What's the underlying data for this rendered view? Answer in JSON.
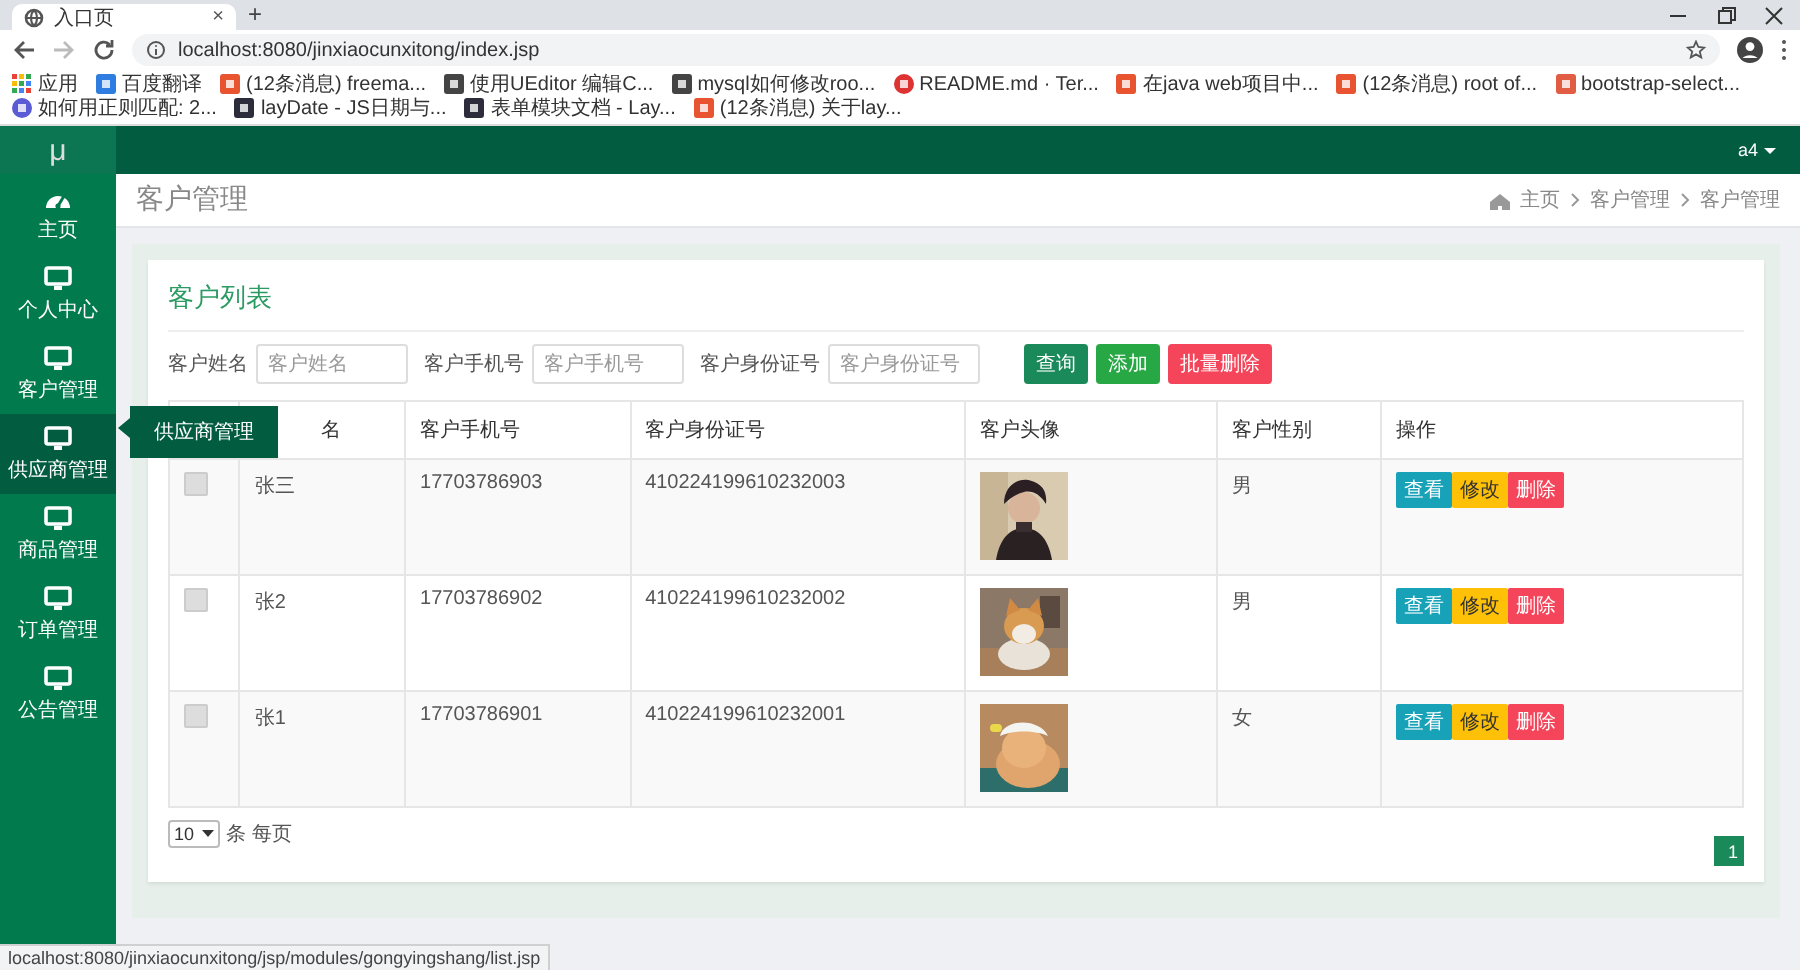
{
  "browser": {
    "tab": {
      "title": "入口页",
      "close": "×"
    },
    "new_tab": "+",
    "address": "localhost:8080/jinxiaocunxitong/index.jsp",
    "bookmarks": [
      {
        "label": "应用",
        "kind": "apps"
      },
      {
        "label": "百度翻译",
        "kind": "translate"
      },
      {
        "label": "(12条消息) freema...",
        "kind": "csdn"
      },
      {
        "label": "使用UEditor 编辑C...",
        "kind": "github"
      },
      {
        "label": "mysql如何修改roo...",
        "kind": "github"
      },
      {
        "label": "README.md · Ter...",
        "kind": "readme"
      },
      {
        "label": "在java web项目中...",
        "kind": "csdn"
      },
      {
        "label": "(12条消息) root of...",
        "kind": "csdn"
      },
      {
        "label": "bootstrap-select...",
        "kind": "bootstrap"
      },
      {
        "label": "如何用正则匹配: 2...",
        "kind": "regex"
      },
      {
        "label": "layDate - JS日期与...",
        "kind": "layui"
      },
      {
        "label": "表单模块文档 - Lay...",
        "kind": "layui"
      },
      {
        "label": "(12条消息) 关于lay...",
        "kind": "csdn"
      }
    ],
    "status_url": "localhost:8080/jinxiaocunxitong/jsp/modules/gongyingshang/list.jsp"
  },
  "app": {
    "logo": "μ",
    "user": "a4"
  },
  "sidebar": {
    "items": [
      {
        "label": "主页",
        "kind": "dashboard",
        "hovered": false
      },
      {
        "label": "个人中心",
        "kind": "monitor",
        "hovered": false
      },
      {
        "label": "客户管理",
        "kind": "monitor",
        "hovered": false
      },
      {
        "label": "供应商管理",
        "kind": "monitor",
        "hovered": true,
        "tooltip": "供应商管理"
      },
      {
        "label": "商品管理",
        "kind": "monitor",
        "hovered": false
      },
      {
        "label": "订单管理",
        "kind": "monitor",
        "hovered": false
      },
      {
        "label": "公告管理",
        "kind": "monitor",
        "hovered": false
      }
    ]
  },
  "page": {
    "title": "客户管理",
    "breadcrumb": [
      "主页",
      "客户管理",
      "客户管理"
    ]
  },
  "card": {
    "title": "客户列表",
    "filters": [
      {
        "label": "客户姓名",
        "placeholder": "客户姓名"
      },
      {
        "label": "客户手机号",
        "placeholder": "客户手机号"
      },
      {
        "label": "客户身份证号",
        "placeholder": "客户身份证号"
      }
    ],
    "buttons": [
      {
        "label": "查询",
        "kind": "search"
      },
      {
        "label": "添加",
        "kind": "add"
      },
      {
        "label": "批量删除",
        "kind": "danger"
      }
    ]
  },
  "table": {
    "columns": [
      "名",
      "客户手机号",
      "客户身份证号",
      "客户头像",
      "客户性别",
      "操作"
    ],
    "rows": [
      {
        "checked": false,
        "name": "张三",
        "phone": "17703786903",
        "id_number": "410224199610232003",
        "gender": "男",
        "actions": [
          {
            "label": "查看",
            "kind": "view"
          },
          {
            "label": "修改",
            "kind": "edit"
          },
          {
            "label": "删除",
            "kind": "delete"
          }
        ]
      },
      {
        "checked": false,
        "name": "张2",
        "phone": "17703786902",
        "id_number": "410224199610232002",
        "gender": "男",
        "actions": [
          {
            "label": "查看",
            "kind": "view"
          },
          {
            "label": "修改",
            "kind": "edit"
          },
          {
            "label": "删除",
            "kind": "delete"
          }
        ]
      },
      {
        "checked": false,
        "name": "张1",
        "phone": "17703786901",
        "id_number": "410224199610232001",
        "gender": "女",
        "actions": [
          {
            "label": "查看",
            "kind": "view"
          },
          {
            "label": "修改",
            "kind": "edit"
          },
          {
            "label": "删除",
            "kind": "delete"
          }
        ]
      }
    ]
  },
  "pagination": {
    "page_size": "10",
    "per_page_label": "条 每页",
    "pages": [
      {
        "label": "1",
        "selected": true
      }
    ]
  }
}
